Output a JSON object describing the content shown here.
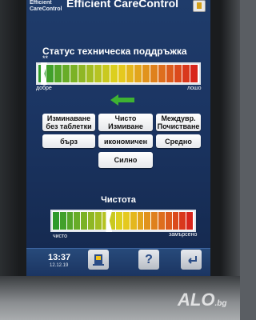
{
  "header": {
    "brand_small_line1": "Efficient",
    "brand_small_line2": "CareControl",
    "brand_title": "Efficient CareControl",
    "icon": "detergent-tablet-icon"
  },
  "status_section": {
    "title": "Статус техническа поддръжка",
    "stars": "**",
    "label_left": "добре",
    "label_right": "лошо",
    "level": 0.03
  },
  "arrow_icon": "arrow-left-green-icon",
  "buttons": [
    {
      "id": "rinse-no-tablet",
      "label": "Изминаване\nбез таблетки"
    },
    {
      "id": "light-clean",
      "label": "Чисто\nИзмиване"
    },
    {
      "id": "interim-clean",
      "label": "Междувр.\nПочистване"
    },
    {
      "id": "fast",
      "label": "бърз"
    },
    {
      "id": "eco",
      "label": "икономичен"
    },
    {
      "id": "medium",
      "label": "Средно"
    },
    {
      "id": "strong",
      "label": "Силно"
    }
  ],
  "clean_section": {
    "title": "Чистота",
    "label_left": "чисто",
    "label_right": "замърсено",
    "level": 0.39
  },
  "footer": {
    "time": "13:37",
    "date": "12.12.19",
    "buttons": [
      {
        "id": "tablet",
        "icon": "tablet-dispenser-icon"
      },
      {
        "id": "help",
        "icon": "help-icon",
        "label": "?"
      },
      {
        "id": "back",
        "icon": "back-arrow-icon"
      }
    ]
  },
  "watermark": {
    "text": "ALO",
    "suffix": ".bg"
  },
  "colors": {
    "screen_top": "#1f3c6b",
    "gauge_green": "#2e9a2c",
    "gauge_yellow": "#e6d21e",
    "gauge_red": "#d8261c",
    "arrow_green": "#3eb232"
  }
}
